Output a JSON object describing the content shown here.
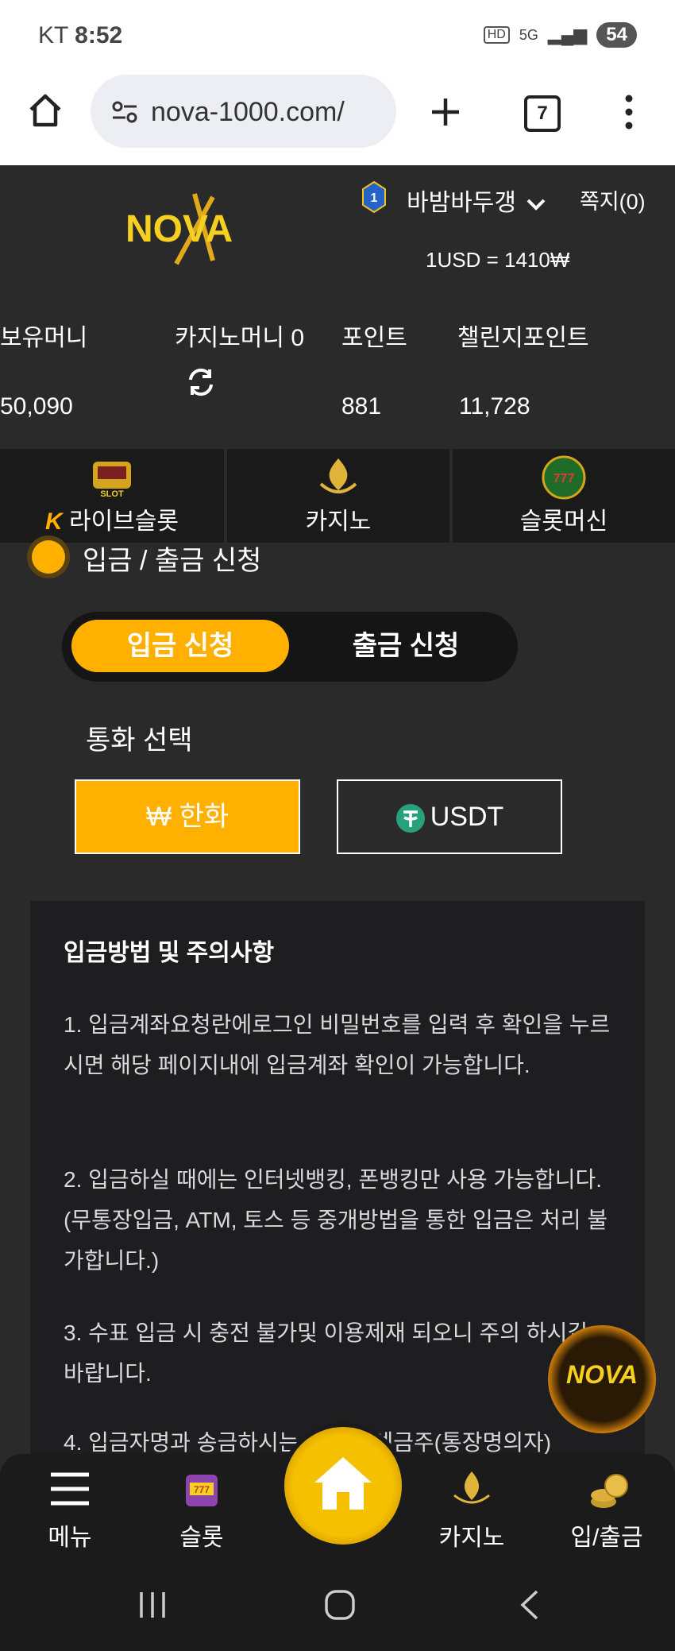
{
  "status_bar": {
    "carrier": "KT",
    "time": "8:52",
    "battery": "54"
  },
  "browser": {
    "url": "nova-1000.com/",
    "tab_count": "7"
  },
  "header": {
    "logo_text": "NOVA",
    "level": "1",
    "username": "바밤바두갱",
    "message_link": "쪽지(0)",
    "exchange_rate": "1USD = 1410₩"
  },
  "balances": [
    {
      "label": "보유머니",
      "value": "50,090"
    },
    {
      "label": "카지노머니 0",
      "value": ""
    },
    {
      "label": "포인트",
      "value": "881"
    },
    {
      "label": "챌린지포인트",
      "value": "11,728"
    }
  ],
  "game_nav": [
    {
      "label": "라이브슬롯",
      "prefix": "K"
    },
    {
      "label": "카지노"
    },
    {
      "label": "슬롯머신"
    }
  ],
  "section_title": "입금 / 출금 신청",
  "tabs": {
    "deposit": "입금 신청",
    "withdraw": "출금 신청"
  },
  "currency": {
    "title": "통화 선택",
    "krw": "₩ 한화",
    "usdt": "USDT"
  },
  "notice": {
    "title": "입금방법 및 주의사항",
    "items": [
      "1. 입금계좌요청란에로그인 비밀번호를 입력 후 확인을 누르시면 해당 페이지내에 입금계좌 확인이 가능합니다.",
      "2. 입금하실 때에는 인터넷뱅킹, 폰뱅킹만 사용 가능합니다.(무통장입금, ATM, 토스 등 중개방법을 통한 입금은 처리 불가합니다.)",
      "3. 수표 입금 시 충전 불가및 이용제재 되오니 주의 하시길 바랍니다.",
      "4. 입금자명과 송금하시는 계좌의 예금주(통장명의자)"
    ]
  },
  "floating_logo": "NOVA",
  "bottom_nav": {
    "menu": "메뉴",
    "slot": "슬롯",
    "casino": "카지노",
    "deposit_withdraw": "입/출금"
  },
  "colors": {
    "accent": "#ffb000",
    "background": "#2a2a2b",
    "panel": "#1e1e20"
  }
}
